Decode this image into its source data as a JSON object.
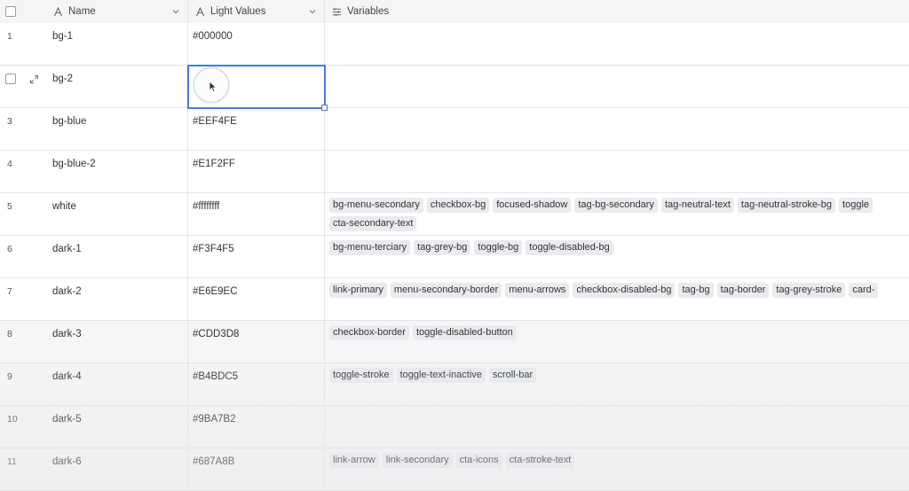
{
  "header": {
    "name_label": "Name",
    "light_label": "Light Values",
    "vars_label": "Variables"
  },
  "icons": {
    "name_col": "text-field-icon",
    "light_col": "text-field-icon",
    "vars_col": "multi-select-icon",
    "dropdown": "chevron-down-icon",
    "expand": "expand-record-icon",
    "cursor": "mouse-pointer-icon"
  },
  "colors": {
    "selection": "#4a78d6",
    "tag_bg": "#e9ebee"
  },
  "rows": [
    {
      "num": "1",
      "name": "bg-1",
      "light": "#000000",
      "vars": []
    },
    {
      "num": "",
      "name": "bg-2",
      "light": "",
      "vars": []
    },
    {
      "num": "3",
      "name": "bg-blue",
      "light": "#EEF4FE",
      "vars": []
    },
    {
      "num": "4",
      "name": "bg-blue-2",
      "light": "#E1F2FF",
      "vars": []
    },
    {
      "num": "5",
      "name": "white",
      "light": "#ffffffff",
      "vars": [
        "bg-menu-secondary",
        "checkbox-bg",
        "focused-shadow",
        "tag-bg-secondary",
        "tag-neutral-text",
        "tag-neutral-stroke-bg",
        "toggle",
        "cta-secondary-text"
      ]
    },
    {
      "num": "6",
      "name": "dark-1",
      "light": "#F3F4F5",
      "vars": [
        "bg-menu-terciary",
        "tag-grey-bg",
        "toggle-bg",
        "toggle-disabled-bg"
      ]
    },
    {
      "num": "7",
      "name": "dark-2",
      "light": "#E6E9EC",
      "vars": [
        "link-primary",
        "menu-secondary-border",
        "menu-arrows",
        "checkbox-disabled-bg",
        "tag-bg",
        "tag-border",
        "tag-grey-stroke",
        "card-"
      ]
    },
    {
      "num": "8",
      "name": "dark-3",
      "light": "#CDD3D8",
      "vars": [
        "checkbox-border",
        "toggle-disabled-button"
      ]
    },
    {
      "num": "9",
      "name": "dark-4",
      "light": "#B4BDC5",
      "vars": [
        "toggle-stroke",
        "toggle-text-inactive",
        "scroll-bar"
      ]
    },
    {
      "num": "10",
      "name": "dark-5",
      "light": "#9BA7B2",
      "vars": []
    },
    {
      "num": "11",
      "name": "dark-6",
      "light": "#687A8B",
      "vars": [
        "link-arrow",
        "link-secondary",
        "cta-icons",
        "cta-stroke-text"
      ]
    }
  ]
}
